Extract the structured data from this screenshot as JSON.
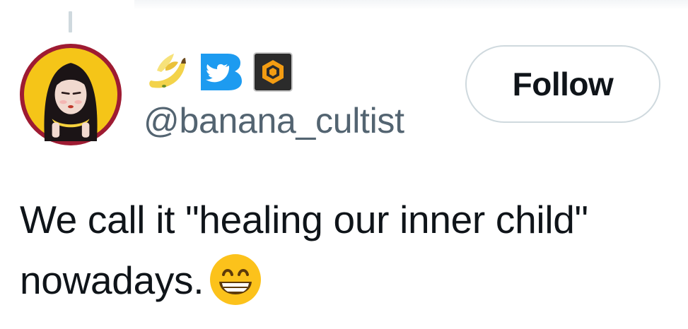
{
  "author": {
    "handle": "@banana_cultist",
    "avatar_icon": "avatar-portrait-icon",
    "badges": [
      "banana-emoji-icon",
      "twitter-bluebird-badge-icon",
      "gem-cube-badge-icon"
    ]
  },
  "actions": {
    "follow_label": "Follow"
  },
  "tweet": {
    "text": "We call it \"healing our inner child\" nowadays.",
    "emoji": "grinning-face-icon"
  },
  "colors": {
    "text_primary": "#0f1419",
    "text_secondary": "#536471",
    "border": "#cfd9de",
    "twitter_blue": "#1d9bf0",
    "avatar_ring": "#9e1b32",
    "avatar_bg": "#f5c518"
  }
}
